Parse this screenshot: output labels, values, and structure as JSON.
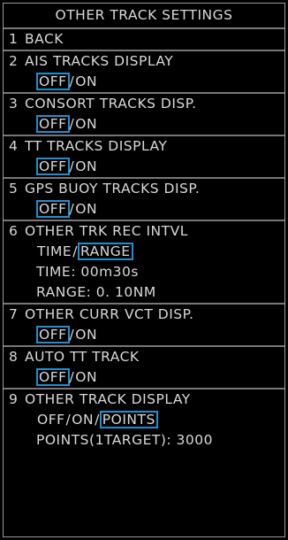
{
  "menu": {
    "title": "OTHER TRACK SETTINGS",
    "items": [
      {
        "num": "1",
        "label": "BACK"
      },
      {
        "num": "2",
        "label": "AIS TRACKS DISPLAY",
        "options": [
          "OFF",
          "ON"
        ],
        "separator": "/",
        "selected": "OFF"
      },
      {
        "num": "3",
        "label": "CONSORT TRACKS DISP.",
        "options": [
          "OFF",
          "ON"
        ],
        "separator": "/",
        "selected": "OFF"
      },
      {
        "num": "4",
        "label": "TT TRACKS DISPLAY",
        "options": [
          "OFF",
          "ON"
        ],
        "separator": "/",
        "selected": "OFF"
      },
      {
        "num": "5",
        "label": "GPS BUOY TRACKS DISP.",
        "options": [
          "OFF",
          "ON"
        ],
        "separator": "/",
        "selected": "OFF"
      },
      {
        "num": "6",
        "label": "OTHER TRK REC INTVL",
        "options": [
          "TIME",
          "RANGE"
        ],
        "separator": "/",
        "selected": "RANGE",
        "details": [
          "TIME: 00m30s",
          "RANGE: 0. 10NM"
        ]
      },
      {
        "num": "7",
        "label": "OTHER CURR VCT DISP.",
        "options": [
          "OFF",
          "ON"
        ],
        "separator": "/",
        "selected": "OFF"
      },
      {
        "num": "8",
        "label": "AUTO TT TRACK",
        "options": [
          "OFF",
          "ON"
        ],
        "separator": "/",
        "selected": "OFF"
      },
      {
        "num": "9",
        "label": "OTHER TRACK DISPLAY",
        "options": [
          "OFF",
          "ON",
          "POINTS"
        ],
        "separator": "/",
        "selected": "POINTS",
        "details": [
          "POINTS(1TARGET): 3000"
        ]
      }
    ]
  },
  "colors": {
    "background": "#000000",
    "text": "#d8d8d8",
    "selection_border": "#1f8fcf",
    "divider": "#777777"
  }
}
